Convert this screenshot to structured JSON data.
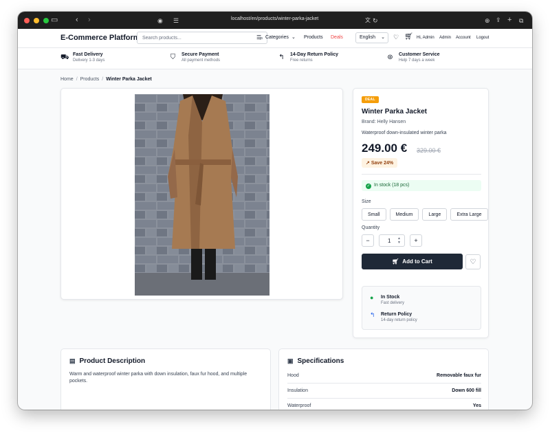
{
  "browser": {
    "url": "localhost/en/products/winter-parka-jacket",
    "traffic_colors": [
      "#ff5f57",
      "#febc2e",
      "#28c840"
    ]
  },
  "nav": {
    "brand": "E-Commerce Platform",
    "search_placeholder": "Search products...",
    "categories": "Categories",
    "products": "Products",
    "deals": "Deals",
    "language": "English",
    "greeting": "Hi, Admin",
    "admin": "Admin",
    "account": "Account",
    "logout": "Logout",
    "deals_color": "#ef4444"
  },
  "features": [
    {
      "title": "Fast Delivery",
      "subtitle": "Delivery 1-3 days",
      "icon": "truck-icon"
    },
    {
      "title": "Secure Payment",
      "subtitle": "All payment methods",
      "icon": "shield-icon"
    },
    {
      "title": "14-Day Return Policy",
      "subtitle": "Free returns",
      "icon": "return-arrow-icon"
    },
    {
      "title": "Customer Service",
      "subtitle": "Help 7 days a week",
      "icon": "support-icon"
    }
  ],
  "breadcrumb": {
    "home": "Home",
    "products": "Products",
    "current": "Winter Parka Jacket"
  },
  "product": {
    "badge": "DEAL",
    "title": "Winter Parka Jacket",
    "brand": "Brand: Helly Hansen",
    "description": "Waterproof down-insulated winter parka",
    "price": "249.00 €",
    "old_price": "329.00 €",
    "save": "Save 24%",
    "stock": "In stock (18 pcs)",
    "size_label": "Size",
    "sizes": [
      "Small",
      "Medium",
      "Large",
      "Extra Large"
    ],
    "quantity_label": "Quantity",
    "quantity": "1",
    "add_to_cart": "Add to Cart",
    "info": [
      {
        "title": "In Stock",
        "subtitle": "Fast delivery",
        "icon": "check-circle-icon"
      },
      {
        "title": "Return Policy",
        "subtitle": "14-day return policy",
        "icon": "return-arrow-icon"
      }
    ]
  },
  "description_card": {
    "title": "Product Description",
    "text": "Warm and waterproof winter parka with down insulation, faux fur hood, and multiple pockets."
  },
  "specs_card": {
    "title": "Specifications",
    "rows": [
      {
        "key": "Hood",
        "value": "Removable faux fur"
      },
      {
        "key": "Insulation",
        "value": "Down 600 fill"
      },
      {
        "key": "Waterproof",
        "value": "Yes"
      }
    ]
  }
}
